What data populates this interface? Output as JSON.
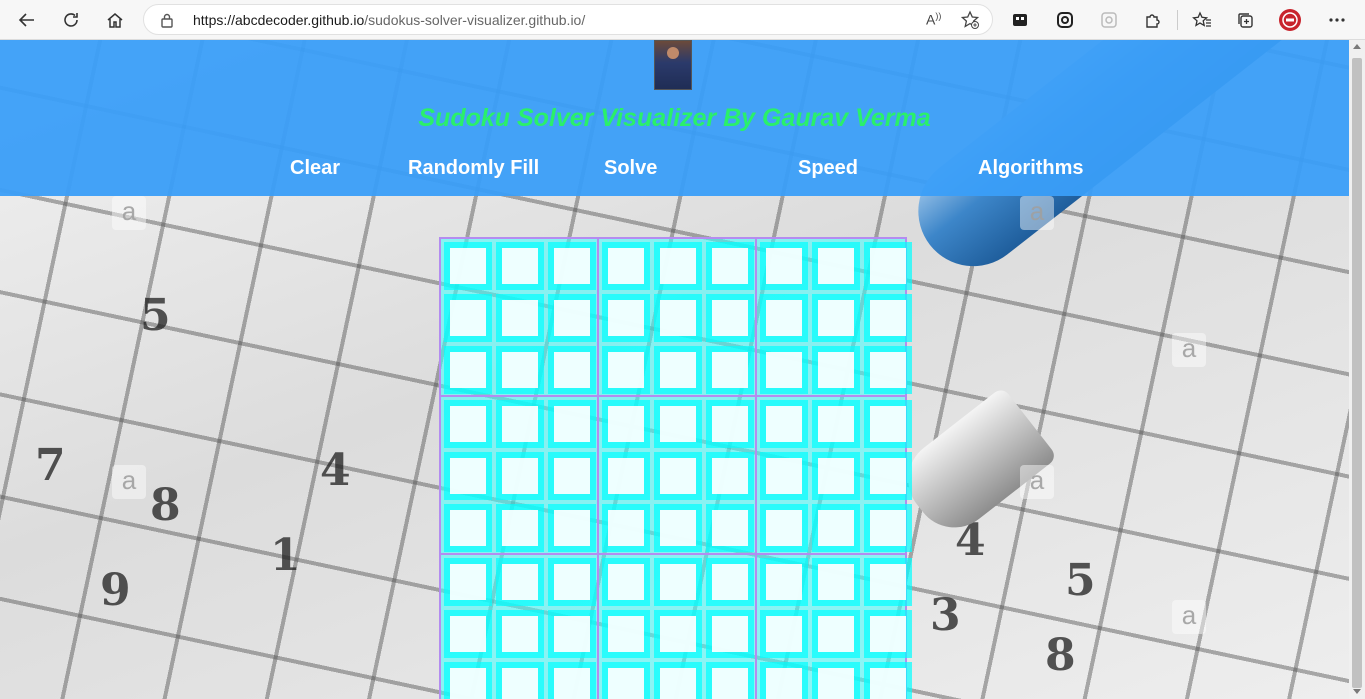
{
  "browser": {
    "url_host": "https://abcdecoder.github.io",
    "url_path": "/sudokus-solver-visualizer.github.io/",
    "read_aloud_label": "A",
    "icons": [
      "back-icon",
      "refresh-icon",
      "home-icon",
      "lock-icon",
      "read-aloud-icon",
      "add-favorite-icon",
      "extension-icon",
      "sync-icon",
      "extension-2-icon",
      "puzzle-icon",
      "favorites-icon",
      "collections-icon",
      "profile-icon",
      "more-icon"
    ]
  },
  "header": {
    "title": "Sudoku Solver Visualizer By Gaurav Verma",
    "menu": [
      {
        "label": "Clear"
      },
      {
        "label": "Randomly Fill"
      },
      {
        "label": "Solve"
      },
      {
        "label": "Speed"
      },
      {
        "label": "Algorithms"
      }
    ]
  },
  "background_numbers": [
    "5",
    "7",
    "8",
    "4",
    "1",
    "9",
    "4",
    "5",
    "3",
    "8"
  ],
  "watermark_letter": "a",
  "colors": {
    "header_bg": "#3a9ef8",
    "title": "#2af06a",
    "board_border": "#b48cf0",
    "cell": "#00ffff"
  },
  "board": {
    "size": 9,
    "cells": [
      [
        "",
        "",
        "",
        "",
        "",
        "",
        "",
        "",
        ""
      ],
      [
        "",
        "",
        "",
        "",
        "",
        "",
        "",
        "",
        ""
      ],
      [
        "",
        "",
        "",
        "",
        "",
        "",
        "",
        "",
        ""
      ],
      [
        "",
        "",
        "",
        "",
        "",
        "",
        "",
        "",
        ""
      ],
      [
        "",
        "",
        "",
        "",
        "",
        "",
        "",
        "",
        ""
      ],
      [
        "",
        "",
        "",
        "",
        "",
        "",
        "",
        "",
        ""
      ],
      [
        "",
        "",
        "",
        "",
        "",
        "",
        "",
        "",
        ""
      ],
      [
        "",
        "",
        "",
        "",
        "",
        "",
        "",
        "",
        ""
      ],
      [
        "",
        "",
        "",
        "",
        "",
        "",
        "",
        "",
        ""
      ]
    ]
  }
}
